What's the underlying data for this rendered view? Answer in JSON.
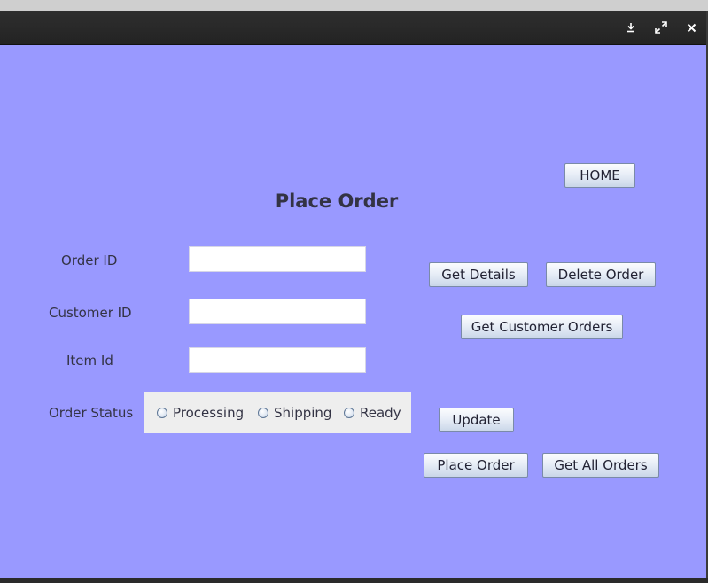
{
  "window": {
    "icons": {
      "download": "download-icon",
      "maximize": "maximize-icon",
      "close": "close-icon"
    }
  },
  "form": {
    "title": "Place Order",
    "labels": {
      "order_id": "Order ID",
      "customer_id": "Customer ID",
      "item_id": "Item Id",
      "order_status": "Order Status"
    },
    "inputs": {
      "order_id": "",
      "customer_id": "",
      "item_id": ""
    },
    "status_options": [
      "Processing",
      "Shipping",
      "Ready"
    ],
    "selected_status": null
  },
  "buttons": {
    "home": "HOME",
    "get_details": "Get Details",
    "delete_order": "Delete Order",
    "get_customer_orders": "Get Customer Orders",
    "update": "Update",
    "place_order": "Place Order",
    "get_all_orders": "Get All Orders"
  },
  "colors": {
    "background": "#9999ff",
    "status_panel": "#eeeeee",
    "titlebar": "#2b2b2b"
  }
}
